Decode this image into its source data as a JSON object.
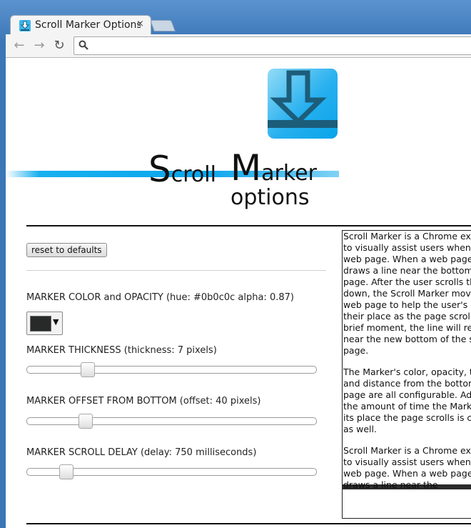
{
  "browser": {
    "tab_title": "Scroll Marker Options",
    "tab_close": "×",
    "back_glyph": "←",
    "forward_glyph": "→",
    "reload_glyph": "↻",
    "address": ""
  },
  "header": {
    "title_part_scroll": "Scroll",
    "title_part_marker": "Marker",
    "title_part_options": "options"
  },
  "controls": {
    "reset_label": "reset to defaults",
    "color": {
      "label": "MARKER COLOR and OPACITY (hue: #0b0c0c alpha: 0.87)",
      "value": "#0b0c0c",
      "alpha": 0.87,
      "dropdown_glyph": "▼"
    },
    "thickness": {
      "label": "MARKER THICKNESS (thickness: 7 pixels)",
      "value": 7
    },
    "offset": {
      "label": "MARKER OFFSET FROM BOTTOM (offset: 40 pixels)",
      "value": 40
    },
    "delay": {
      "label": "MARKER SCROLL DELAY (delay: 750 milliseconds)",
      "value": 750
    }
  },
  "description": {
    "paragraph1": "Scroll Marker is a Chrome extension used to visually assist users when scrolling a web page. When a web page loads, it draws a line near the bottom of the page. After the user scrolls the web page down, the Scroll Marker moves with the web page to help the user's eyes keep their place as the page scrolls. After a brief moment, the line will redraw itself near the new bottom of the scrolled page.",
    "paragraph2": "The Marker's color, opacity, thickness, and distance from the bottom of the web page are all configurable. Additionally, the amount of time the Marker stays in its place the page scrolls is configurable as well.",
    "paragraph3": "Scroll Marker is a Chrome extension used to visually assist users when scrolling a web page. When a web page loads, it draws a line near the"
  },
  "colors": {
    "brand_blue": "#0aa6ec",
    "logo_dark": "#1c5d7a"
  }
}
